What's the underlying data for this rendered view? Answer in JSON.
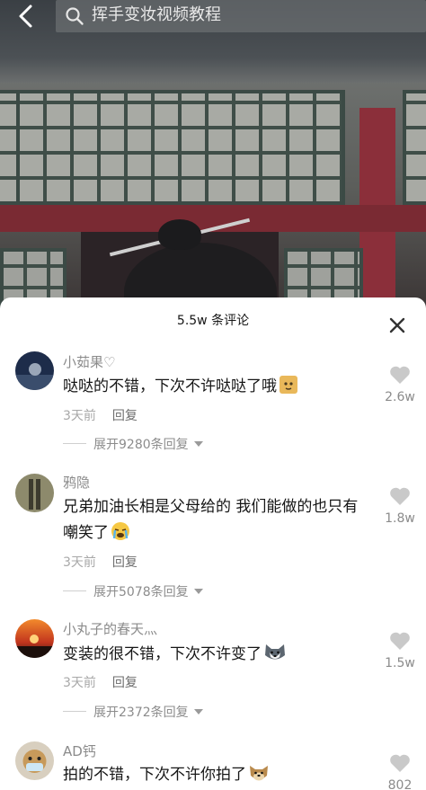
{
  "header": {
    "search_text": "挥手变妆视频教程"
  },
  "comments_panel": {
    "title": "5.5w 条评论",
    "reply_label": "回复",
    "comments": [
      {
        "username": "小茹果♡",
        "text": "哒哒的不错，下次不许哒哒了哦",
        "emoji": "cat-face-icon",
        "time": "3天前",
        "likes": "2.6w",
        "expand": "展开9280条回复"
      },
      {
        "username": "鸦隐",
        "text": "兄弟加油长相是父母给的 我们能做的也只有嘲笑了",
        "emoji": "crying-face-icon",
        "time": "3天前",
        "likes": "1.8w",
        "expand": "展开5078条回复"
      },
      {
        "username": "小丸子的春天灬",
        "text": "变装的很不错，下次不许变了",
        "emoji": "husky-face-icon",
        "time": "3天前",
        "likes": "1.5w",
        "expand": "展开2372条回复"
      },
      {
        "username": "AD钙",
        "text": "拍的不错，下次不许你拍了",
        "emoji": "dog-face-icon",
        "likes": "802"
      }
    ]
  }
}
